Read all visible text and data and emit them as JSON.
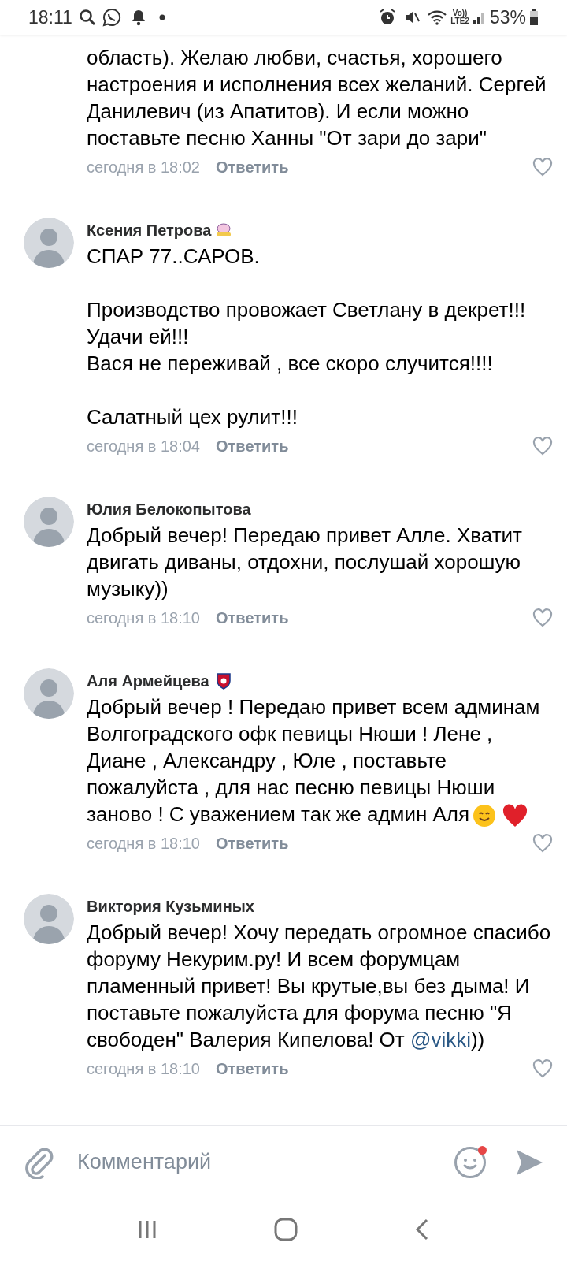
{
  "status_bar": {
    "time": "18:11",
    "volte": [
      "Vo))",
      "LTE2"
    ],
    "battery": "53%"
  },
  "comments": [
    {
      "body": "область). Желаю любви, счастья, хорошего настроения и исполнения всех желаний. Сергей Данилевич (из Апатитов). И если можно поставьте песню Ханны \"От зари до зари\"",
      "time": "сегодня в 18:02",
      "reply": "Ответить",
      "liked": false
    },
    {
      "name": "Ксения Петрова",
      "badge": {
        "kind": "sticker"
      },
      "body": "СПАР  77..САРОВ.\n\nПроизводство провожает Светлану в декрет!!!\nУдачи ей!!!\nВася не переживай , все скоро случится!!!!\n\nСалатный цех рулит!!!",
      "time": "сегодня в 18:04",
      "reply": "Ответить",
      "liked": false
    },
    {
      "name": "Юлия Белокопытова",
      "body": "Добрый вечер! Передаю привет Алле. Хватит двигать диваны, отдохни, послушай хорошую музыку))",
      "time": "сегодня в 18:10",
      "reply": "Ответить",
      "liked": false
    },
    {
      "name": "Аля Армейцева",
      "badge": {
        "kind": "club"
      },
      "body": "Добрый вечер ! Передаю привет всем админам Волгоградского офк певицы Нюши ! Лене , Диане , Александру , Юле  , поставьте пожалуйста , для нас песню певицы Нюши заново ! С уважением так же админ Аля",
      "emoji": [
        {
          "kind": "smile"
        },
        {
          "kind": "heart"
        }
      ],
      "time": "сегодня в 18:10",
      "reply": "Ответить",
      "liked": false
    },
    {
      "name": "Виктория Кузьминых",
      "body": "Добрый вечер! Хочу передать  огромное спасибо форуму Некурим.ру! И всем форумцам пламенный привет! Вы крутые,вы без дыма! И поставьте пожалуйста для форума песню \"Я свободен\" Валерия Кипелова! От",
      "mention": "@vikki",
      "body_after": "))",
      "time": "сегодня в 18:10",
      "reply": "Ответить",
      "liked": false
    }
  ],
  "composer": {
    "placeholder": "Комментарий",
    "emoji_notification": true
  }
}
